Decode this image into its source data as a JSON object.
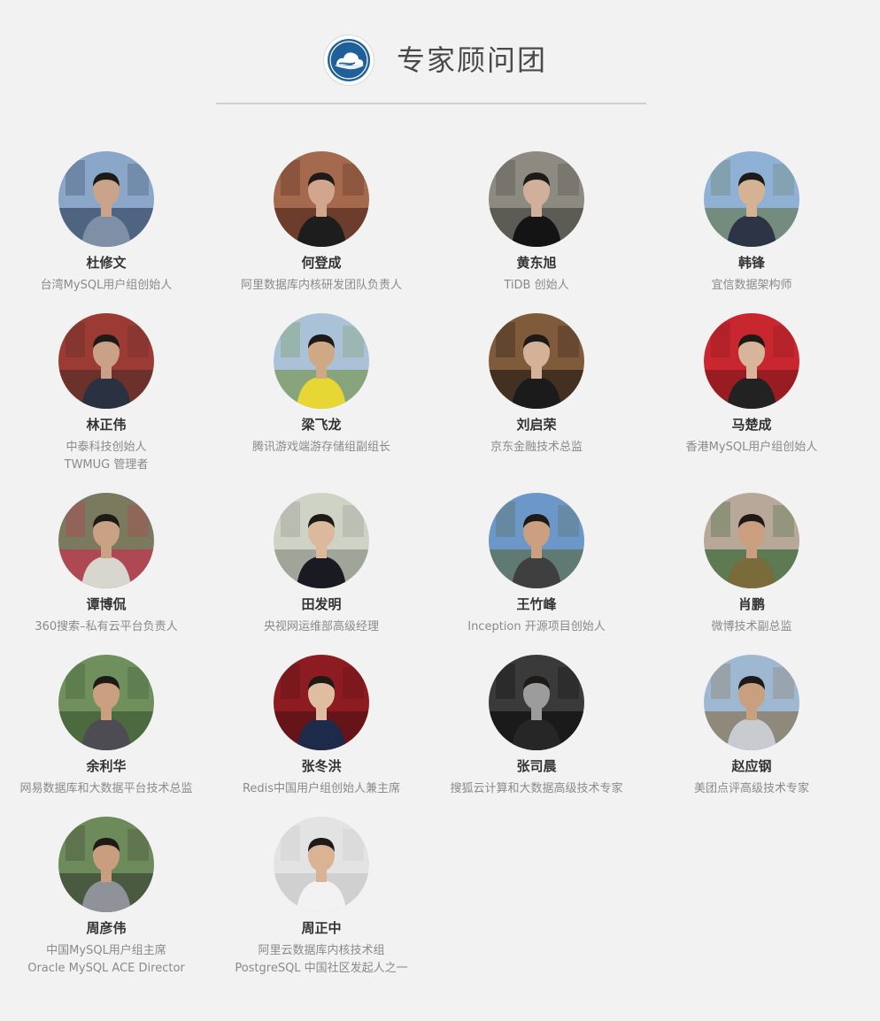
{
  "header": {
    "title": "专家顾问团",
    "logo_icon": "cloud-logo-icon",
    "logo_color": "#1f5f9a"
  },
  "experts": [
    {
      "name": "杜修文",
      "lines": [
        "台湾MySQL用户组创始人"
      ],
      "photo": {
        "bg": "#8aa6c8",
        "fg": "#3a4e6a",
        "skin": "#c9a48a",
        "shirt": "#7f8fa6"
      }
    },
    {
      "name": "何登成",
      "lines": [
        "阿里数据库内核研发团队负责人"
      ],
      "photo": {
        "bg": "#a5694d",
        "fg": "#5a2f22",
        "skin": "#d1a68c",
        "shirt": "#1d1d1d"
      }
    },
    {
      "name": "黄东旭",
      "lines": [
        "TiDB 创始人"
      ],
      "photo": {
        "bg": "#8d8a82",
        "fg": "#4d4b47",
        "skin": "#d0b09a",
        "shirt": "#141414"
      }
    },
    {
      "name": "韩锋",
      "lines": [
        "宜信数据架构师"
      ],
      "photo": {
        "bg": "#8fb1d6",
        "fg": "#6a8060",
        "skin": "#d6b295",
        "shirt": "#2c3445"
      }
    },
    {
      "name": "林正伟",
      "lines": [
        "中泰科技创始人",
        "TWMUG 管理者"
      ],
      "photo": {
        "bg": "#9c3b34",
        "fg": "#5c2f27",
        "skin": "#c9a186",
        "shirt": "#2a3140"
      }
    },
    {
      "name": "梁飞龙",
      "lines": [
        "腾讯游戏端游存储组副组长"
      ],
      "photo": {
        "bg": "#a9c2d8",
        "fg": "#7c9a5e",
        "skin": "#cfa886",
        "shirt": "#e8d634"
      }
    },
    {
      "name": "刘启荣",
      "lines": [
        "京东金融技术总监"
      ],
      "photo": {
        "bg": "#7f5b3b",
        "fg": "#2f2218",
        "skin": "#d4b299",
        "shirt": "#1b1b1b"
      }
    },
    {
      "name": "马楚成",
      "lines": [
        "香港MySQL用户组创始人"
      ],
      "photo": {
        "bg": "#c9272f",
        "fg": "#8a1a20",
        "skin": "#d8b49a",
        "shirt": "#222222"
      }
    },
    {
      "name": "谭博侃",
      "lines": [
        "360搜索–私有云平台负责人"
      ],
      "photo": {
        "bg": "#7a7a5e",
        "fg": "#c03a51",
        "skin": "#c8a283",
        "shirt": "#d7d7d0"
      }
    },
    {
      "name": "田发明",
      "lines": [
        "央视网运维部高级经理"
      ],
      "photo": {
        "bg": "#cfd3c6",
        "fg": "#8f968a",
        "skin": "#dcb99d",
        "shirt": "#1a1a22"
      }
    },
    {
      "name": "王竹峰",
      "lines": [
        "Inception 开源项目创始人"
      ],
      "photo": {
        "bg": "#6c97c9",
        "fg": "#5c6f55",
        "skin": "#caa080",
        "shirt": "#3f3f3f"
      }
    },
    {
      "name": "肖鹏",
      "lines": [
        "微博技术副总监"
      ],
      "photo": {
        "bg": "#b8a89a",
        "fg": "#3f6b3a",
        "skin": "#c99f7f",
        "shirt": "#7a6b3a"
      }
    },
    {
      "name": "余利华",
      "lines": [
        "网易数据库和大数据平台技术总监"
      ],
      "photo": {
        "bg": "#6f8f5c",
        "fg": "#3f5e36",
        "skin": "#c99f7f",
        "shirt": "#4c4c52"
      }
    },
    {
      "name": "张冬洪",
      "lines": [
        "Redis中国用户组创始人兼主席"
      ],
      "photo": {
        "bg": "#8c1c22",
        "fg": "#5a1216",
        "skin": "#e0bca0",
        "shirt": "#1e2a4a"
      }
    },
    {
      "name": "张司晨",
      "lines": [
        "搜狐云计算和大数据高级技术专家"
      ],
      "photo": {
        "bg": "#3a3a3a",
        "fg": "#101010",
        "skin": "#9c9c9c",
        "shirt": "#262626"
      }
    },
    {
      "name": "赵应钢",
      "lines": [
        "美团点评高级技术专家"
      ],
      "photo": {
        "bg": "#9fb8d1",
        "fg": "#8a7a5e",
        "skin": "#c9a07f",
        "shirt": "#c8ccd0"
      }
    },
    {
      "name": "周彦伟",
      "lines": [
        "中国MySQL用户组主席",
        "Oracle MySQL ACE Director"
      ],
      "photo": {
        "bg": "#6d8a5a",
        "fg": "#3f4a3a",
        "skin": "#c89e7e",
        "shirt": "#8f9298"
      }
    },
    {
      "name": "周正中",
      "lines": [
        "阿里云数据库内核技术组",
        "PostgreSQL 中国社区发起人之一"
      ],
      "photo": {
        "bg": "#e3e3e3",
        "fg": "#c9c9c9",
        "skin": "#d9b394",
        "shirt": "#f2f2f2"
      }
    }
  ]
}
